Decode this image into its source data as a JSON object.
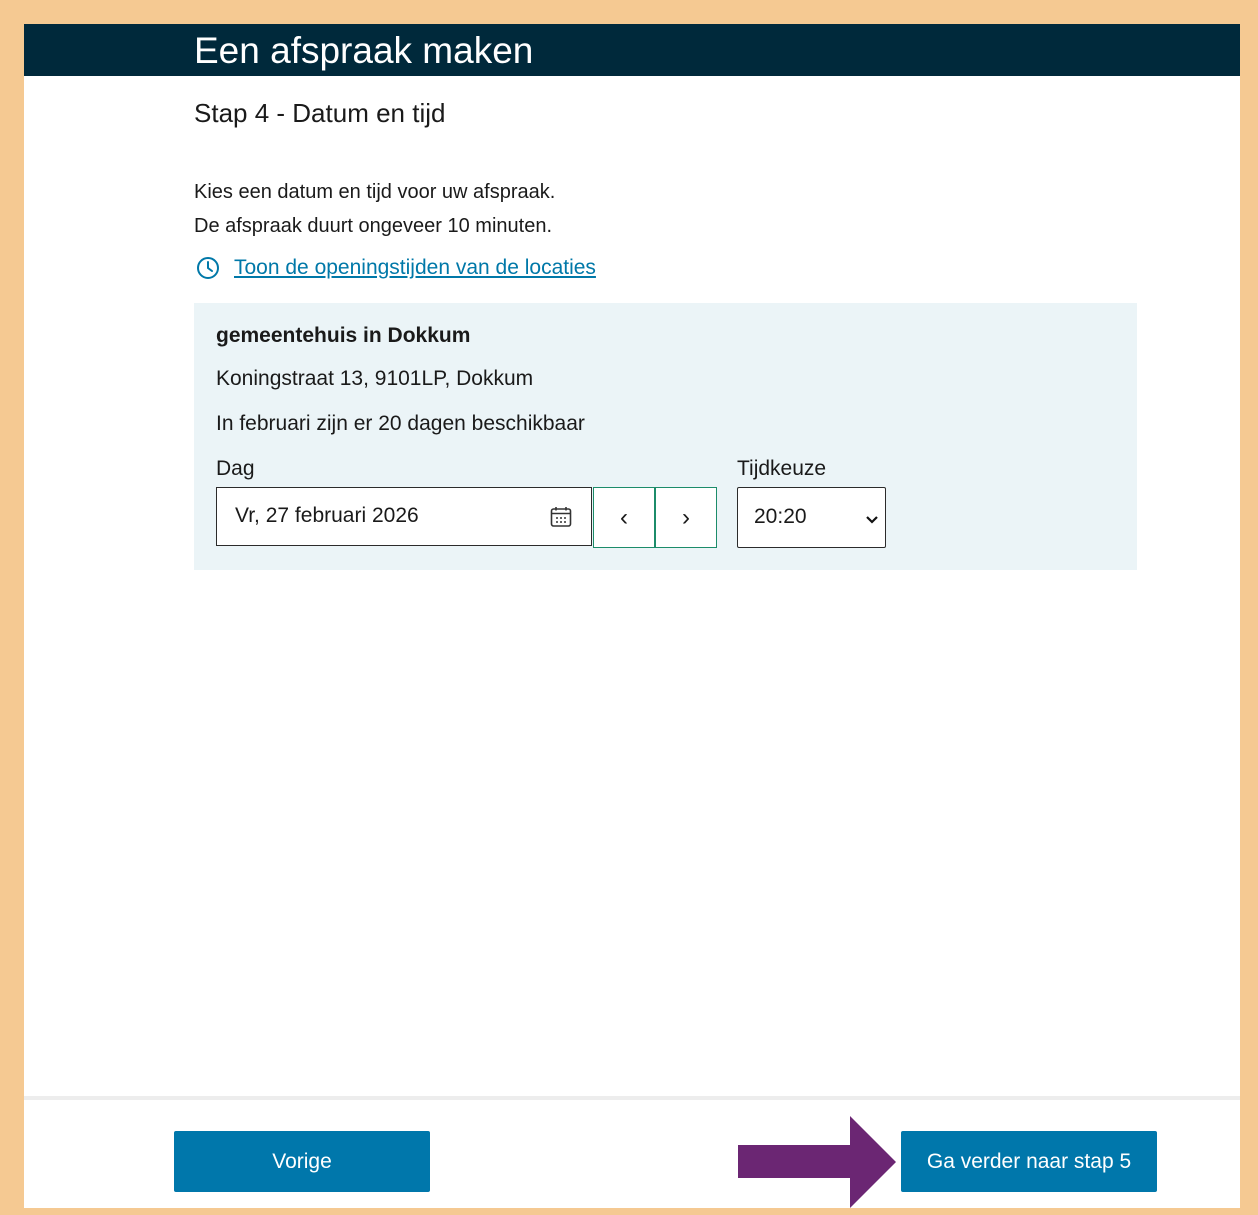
{
  "header": {
    "title": "Een afspraak maken"
  },
  "step": {
    "title": "Stap 4 - Datum en tijd"
  },
  "intro": {
    "line1": "Kies een datum en tijd voor uw afspraak.",
    "line2": "De afspraak duurt ongeveer 10 minuten."
  },
  "hours_link": {
    "label": "Toon de openingstijden van de locaties",
    "icon": "clock-icon"
  },
  "location": {
    "name": "gemeentehuis in Dokkum",
    "address": "Koningstraat 13, 9101LP, Dokkum",
    "availability": "In februari zijn er 20 dagen beschikbaar"
  },
  "date": {
    "label": "Dag",
    "value": "Vr, 27 februari 2026",
    "icon": "calendar-icon",
    "prev_label": "‹",
    "next_label": "›"
  },
  "time": {
    "label": "Tijdkeuze",
    "value": "20:20"
  },
  "footer": {
    "prev_button": "Vorige",
    "next_button": "Ga verder naar stap 5"
  },
  "colors": {
    "header_bg": "#00293b",
    "accent_blue": "#0077ab",
    "panel_bg": "#ebf4f7",
    "nav_border": "#1c8c6a",
    "annotation_arrow": "#6b2673",
    "outer_border": "#f5c992"
  }
}
